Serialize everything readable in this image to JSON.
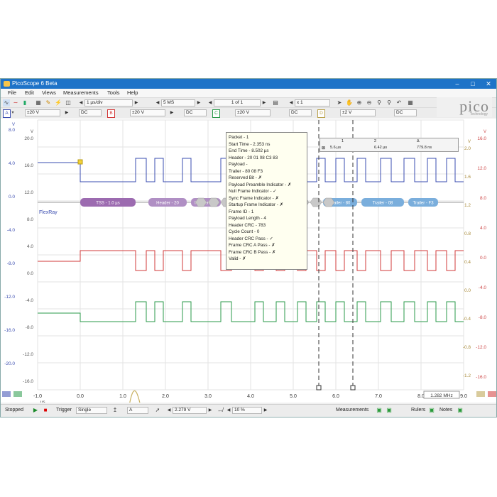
{
  "window": {
    "title": "PicoScope 6 Beta",
    "controls": [
      "–",
      "□",
      "✕"
    ]
  },
  "menu": [
    "File",
    "Edit",
    "Views",
    "Measurements",
    "Tools",
    "Help"
  ],
  "toolbar": {
    "timebase": "1 µs/div",
    "samples": "5 MS",
    "capture": "1 of 1",
    "zoom": "x 1"
  },
  "channels": [
    {
      "letter": "A",
      "range": "±20 V",
      "coupling": "DC",
      "color": "#3a4cb0"
    },
    {
      "letter": "B",
      "range": "±20 V",
      "coupling": "DC",
      "color": "#d23838"
    },
    {
      "letter": "C",
      "range": "±20 V",
      "coupling": "DC",
      "color": "#2a9a4a"
    },
    {
      "letter": "D",
      "range": "±2 V",
      "coupling": "DC",
      "color": "#b9a04a"
    }
  ],
  "brand": {
    "logo": "pico",
    "tagline": "Technology"
  },
  "plot": {
    "xmin": -1.0,
    "xmax": 9.0,
    "x_ticks": [
      "-1.0",
      "0.0",
      "1.0",
      "2.0",
      "3.0",
      "4.0",
      "5.0",
      "6.0",
      "7.0",
      "8.0",
      "9.0"
    ],
    "x_unit": "µs",
    "left_axis_a": [
      "8.0",
      "4.0",
      "0.0",
      "-4.0",
      "-8.0",
      "-12.0",
      "-16.0",
      "-20.0"
    ],
    "left_axis_a_unit": "V",
    "left_axis_b": [
      "20.0",
      "16.0",
      "12.0",
      "8.0",
      "4.0",
      "0.0",
      "-4.0",
      "-8.0",
      "-12.0",
      "-16.0"
    ],
    "left_axis_b_unit": "V",
    "right_axis_c": [
      "16.0",
      "12.0",
      "8.0",
      "4.0",
      "0.0",
      "-4.0",
      "-8.0",
      "-12.0",
      "-16.0"
    ],
    "right_axis_c_unit": "V",
    "right_axis_d": [
      "2.0",
      "1.6",
      "1.2",
      "0.8",
      "0.4",
      "0.0",
      "-0.4",
      "-0.8",
      "-1.2"
    ],
    "right_axis_d_unit": "V",
    "flexray_label": "FlexRay",
    "frequency_readout": "1.282 MHz",
    "ruler_cursor_1": 5.6,
    "ruler_cursor_2": 6.4
  },
  "decoder": {
    "segments": [
      {
        "label": "TSS - 1.0 µs",
        "color": "#9c6bb0"
      },
      {
        "label": "Header - 20",
        "color": "#b08fc4"
      },
      {
        "label": "Header - 01",
        "color": "#b08fc4"
      },
      {
        "label": "Trailer - 80",
        "color": "#7aaedc"
      },
      {
        "label": "Trailer - 08",
        "color": "#7aaedc"
      },
      {
        "label": "Trailer - F3",
        "color": "#7aaedc"
      }
    ]
  },
  "ruler_table": {
    "col1": "1",
    "col2": "2",
    "col3": "Δ",
    "v1": "5.6 µs",
    "v2": "6.42 µs",
    "v3": "779.8 ns"
  },
  "tooltip": [
    "Packet - 1",
    "Start Time - 2.353 ns",
    "End Time - 8.502 µs",
    "Header - 20 01 08 C3 83",
    "Payload -",
    "Trailer - 80 08 F3",
    "Reserved Bit - ✗",
    "Payload Preamble Indicator - ✗",
    "Null Frame Indicator - ✓",
    "Sync Frame Indicator - ✗",
    "Startup Frame Indicator - ✗",
    "Frame ID - 1",
    "Payload Length - 4",
    "Header CRC - 783",
    "Cycle Count - 0",
    "Header CRC Pass - ✓",
    "Frame CRC A Pass - ✗",
    "Frame CRC B Pass - ✗",
    "Valid - ✗"
  ],
  "status": {
    "state": "Stopped",
    "trigger_label": "Trigger",
    "trigger_mode": "Single",
    "trigger_channel": "A",
    "threshold": "2.279 V",
    "pretrigger": "10 %",
    "measurements": "Measurements",
    "rulers": "Rulers",
    "notes": "Notes"
  }
}
